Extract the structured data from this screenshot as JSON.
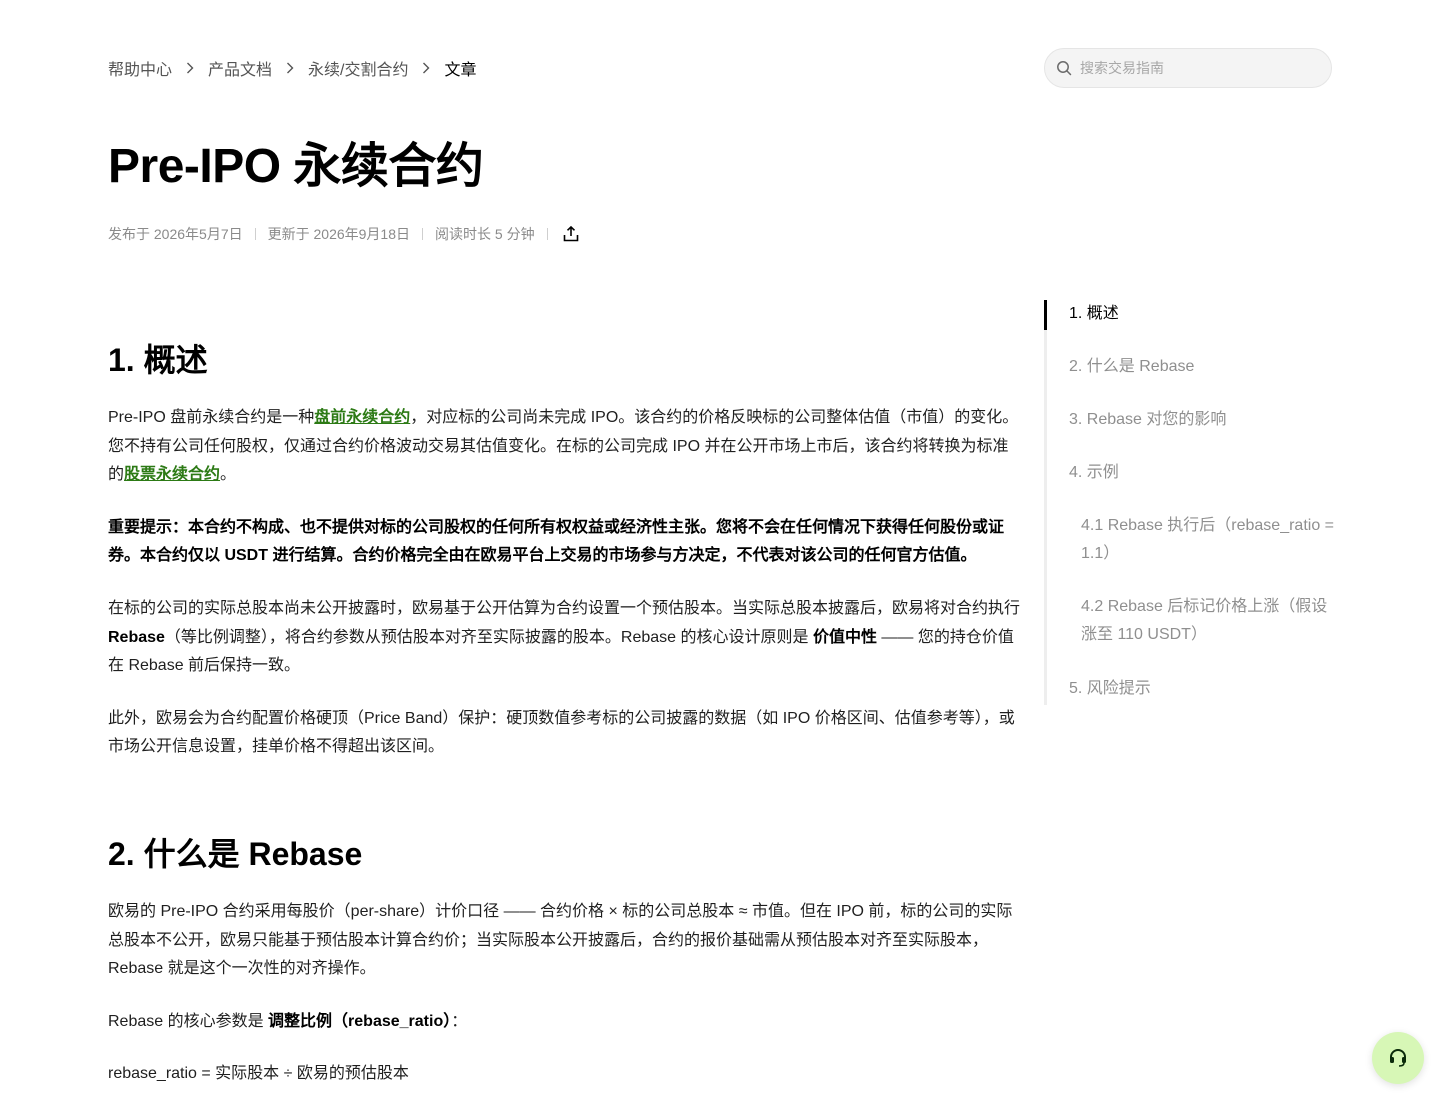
{
  "breadcrumb": {
    "items": [
      "帮助中心",
      "产品文档",
      "永续/交割合约",
      "文章"
    ]
  },
  "search": {
    "placeholder": "搜索交易指南"
  },
  "article": {
    "title": "Pre-IPO 永续合约",
    "published": "发布于 2026年5月7日",
    "updated": "更新于 2026年9月18日",
    "read_time": "阅读时长 5 分钟"
  },
  "sections": {
    "s1": {
      "heading": "1. 概述",
      "p1_a": "Pre-IPO 盘前永续合约是一种",
      "p1_link1": "盘前永续合约",
      "p1_b": "，对应标的公司尚未完成 IPO。该合约的价格反映标的公司整体估值（市值）的变化。您不持有公司任何股权，仅通过合约价格波动交易其估值变化。在标的公司完成 IPO 并在公开市场上市后，该合约将转换为标准的",
      "p1_link2": "股票永续合约",
      "p1_c": "。",
      "p2": "重要提示：本合约不构成、也不提供对标的公司股权的任何所有权权益或经济性主张。您将不会在任何情况下获得任何股份或证券。本合约仅以 USDT 进行结算。合约价格完全由在欧易平台上交易的市场参与方决定，不代表对该公司的任何官方估值。",
      "p3_a": "在标的公司的实际总股本尚未公开披露时，欧易基于公开估算为合约设置一个预估股本。当实际总股本披露后，欧易将对合约执行 ",
      "p3_b1": "Rebase",
      "p3_c": "（等比例调整），将合约参数从预估股本对齐至实际披露的股本。Rebase 的核心设计原则是 ",
      "p3_b2": "价值中性",
      "p3_d": " —— 您的持仓价值在 Rebase 前后保持一致。",
      "p4": "此外，欧易会为合约配置价格硬顶（Price Band）保护：硬顶数值参考标的公司披露的数据（如 IPO 价格区间、估值参考等），或市场公开信息设置，挂单价格不得超出该区间。"
    },
    "s2": {
      "heading": "2. 什么是 Rebase",
      "p1": "欧易的 Pre-IPO 合约采用每股价（per-share）计价口径 —— 合约价格 × 标的公司总股本 ≈ 市值。但在 IPO 前，标的公司的实际总股本不公开，欧易只能基于预估股本计算合约价；当实际股本公开披露后，合约的报价基础需从预估股本对齐至实际股本，Rebase 就是这个一次性的对齐操作。",
      "p2_a": "Rebase 的核心参数是 ",
      "p2_b": "调整比例（rebase_ratio）",
      "p2_c": "：",
      "p3": "rebase_ratio = 实际股本 ÷ 欧易的预估股本"
    }
  },
  "toc": {
    "items": [
      "1. 概述",
      "2. 什么是 Rebase",
      "3. Rebase 对您的影响",
      "4. 示例",
      "4.1 Rebase 执行后（rebase_ratio = 1.1）",
      "4.2 Rebase 后标记价格上涨（假设涨至 110 USDT）",
      "5. 风险提示"
    ],
    "active_index": 0
  },
  "colors": {
    "link": "#2c7a15",
    "support_button": "#d7f7b6",
    "toc_active": "#000000",
    "toc_inactive": "#8f8f8f"
  },
  "icons": {
    "search": "search-icon",
    "chevron": "chevron-right-icon",
    "share": "share-icon",
    "support": "headset-icon"
  }
}
